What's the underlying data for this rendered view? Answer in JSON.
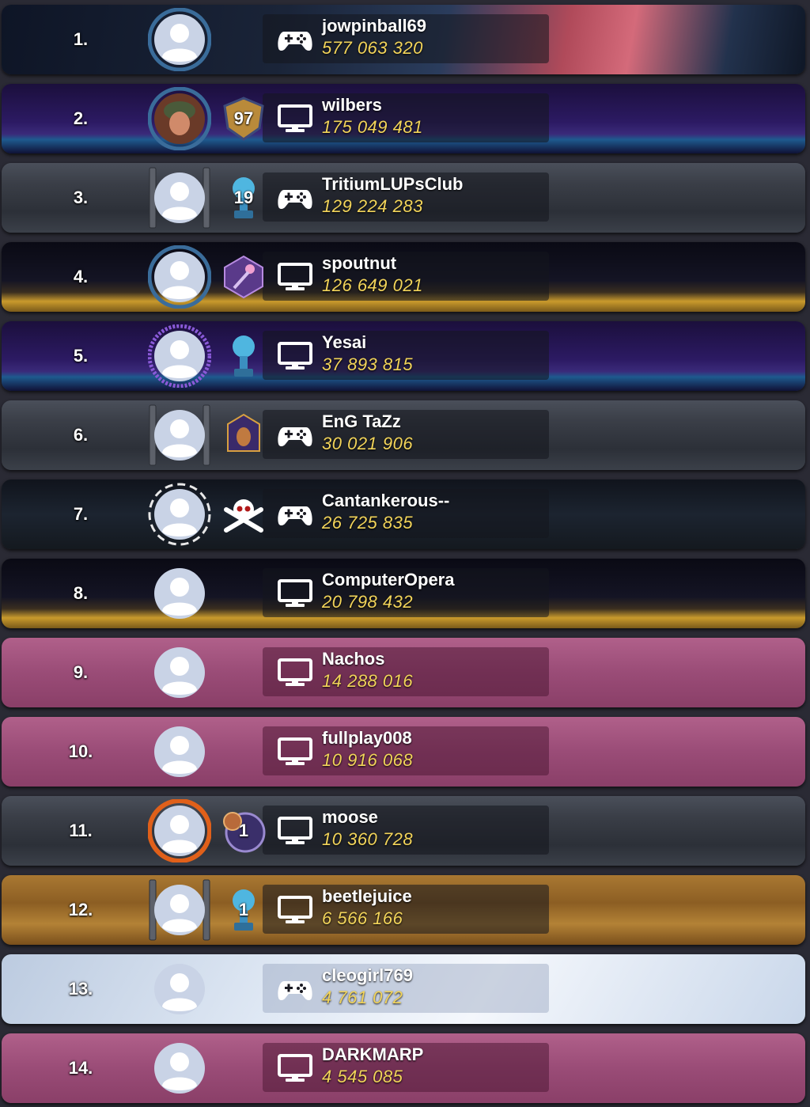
{
  "leaderboard": {
    "entries": [
      {
        "rank": "1.",
        "name": "jowpinball69",
        "score": "577 063 320",
        "device": "gamepad-icon",
        "theme": "neon",
        "avatar_frame": "ring-blue",
        "badge": null
      },
      {
        "rank": "2.",
        "name": "wilbers",
        "score": "175 049 481",
        "device": "monitor-icon",
        "theme": "synth",
        "avatar_frame": "ring-blue",
        "avatar_photo": true,
        "badge": {
          "icon": "level-shield-icon",
          "text": "97"
        }
      },
      {
        "rank": "3.",
        "name": "TritiumLUPsClub",
        "score": "129 224 283",
        "device": "gamepad-icon",
        "theme": "metal",
        "avatar_frame": "metal-brackets",
        "badge": {
          "icon": "blue-trophy-icon",
          "text": "19"
        }
      },
      {
        "rank": "4.",
        "name": "spoutnut",
        "score": "126 649 021",
        "device": "monitor-icon",
        "theme": "moon",
        "avatar_frame": "ring-blue",
        "badge": {
          "icon": "purple-key-icon",
          "text": ""
        }
      },
      {
        "rank": "5.",
        "name": "Yesai",
        "score": "37 893 815",
        "device": "monitor-icon",
        "theme": "synth",
        "avatar_frame": "ring-purple",
        "badge": {
          "icon": "blue-trophy-icon",
          "text": ""
        }
      },
      {
        "rank": "6.",
        "name": "EnG TaZz",
        "score": "30 021 906",
        "device": "gamepad-icon",
        "theme": "metal",
        "avatar_frame": "metal-brackets",
        "badge": {
          "icon": "pharaoh-icon",
          "text": ""
        }
      },
      {
        "rank": "7.",
        "name": "Cantankerous--",
        "score": "26 725 835",
        "device": "gamepad-icon",
        "theme": "pirate",
        "avatar_frame": "skull-frame",
        "badge": {
          "icon": "skull-crossbones-icon",
          "text": ""
        }
      },
      {
        "rank": "8.",
        "name": "ComputerOpera",
        "score": "20 798 432",
        "device": "monitor-icon",
        "theme": "moon",
        "avatar_frame": "none",
        "badge": null
      },
      {
        "rank": "9.",
        "name": "Nachos",
        "score": "14 288 016",
        "device": "monitor-icon",
        "theme": "pink",
        "avatar_frame": "none",
        "badge": null
      },
      {
        "rank": "10.",
        "name": "fullplay008",
        "score": "10 916 068",
        "device": "monitor-icon",
        "theme": "pink",
        "avatar_frame": "none",
        "badge": null
      },
      {
        "rank": "11.",
        "name": "moose",
        "score": "10 360 728",
        "device": "monitor-icon",
        "theme": "metal",
        "avatar_frame": "ring-fire",
        "badge": {
          "icon": "pinball-badge-icon",
          "text": "1"
        }
      },
      {
        "rank": "12.",
        "name": "beetlejuice",
        "score": "6 566 166",
        "device": "monitor-icon",
        "theme": "wood",
        "avatar_frame": "metal-brackets",
        "badge": {
          "icon": "blue-trophy-icon",
          "text": "1"
        }
      },
      {
        "rank": "13.",
        "name": "cleogirl769",
        "score": "4 761 072",
        "device": "gamepad-icon",
        "theme": "cloud",
        "avatar_frame": "none",
        "badge": null
      },
      {
        "rank": "14.",
        "name": "DARKMARP",
        "score": "4 545 085",
        "device": "monitor-icon",
        "theme": "pink",
        "avatar_frame": "none",
        "badge": null
      }
    ]
  },
  "colors": {
    "name_text": "#ffffff",
    "score_text": "#f2d45a",
    "avatar_fill": "#c9d3e6",
    "avatar_silhouette": "#ffffff"
  }
}
